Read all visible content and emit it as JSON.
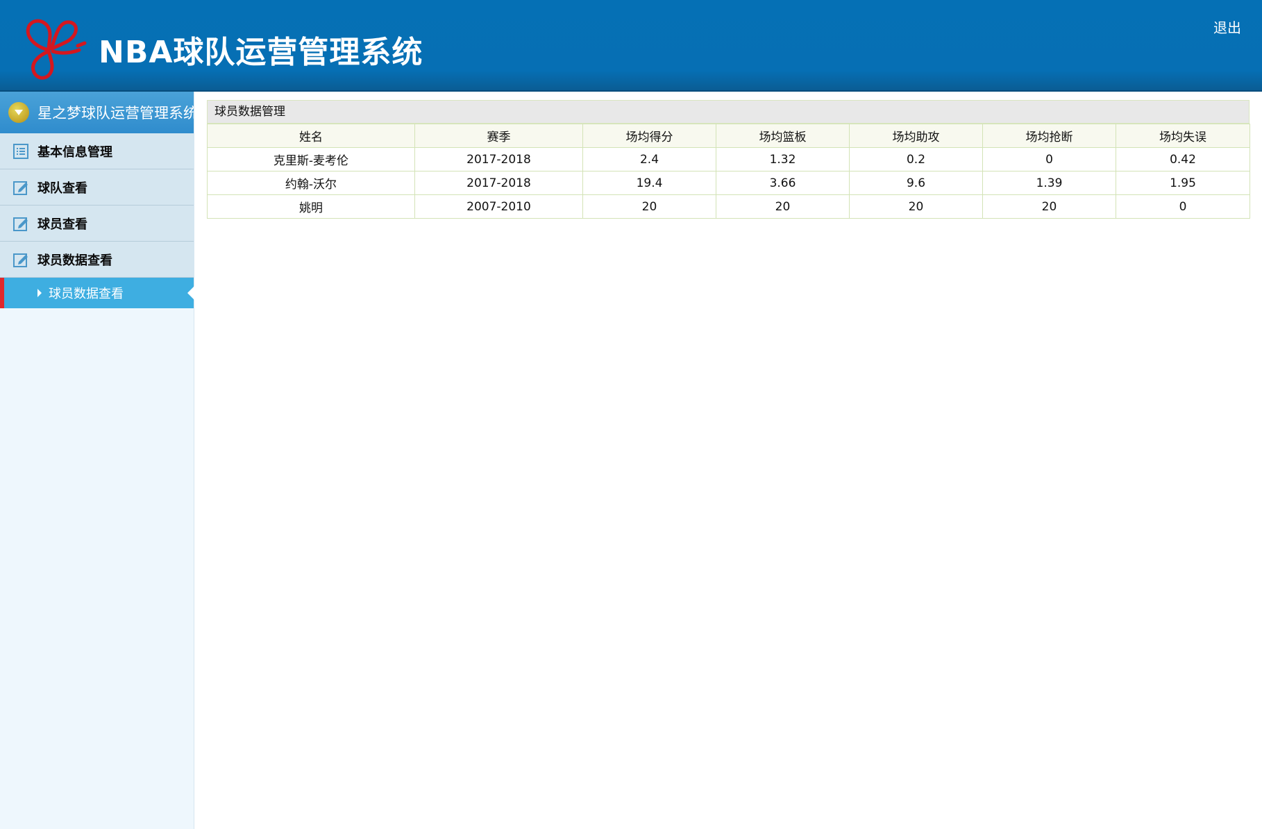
{
  "header": {
    "title": "NBA球队运营管理系统",
    "logout": "退出",
    "logo_icon": "butterfly-logo-icon",
    "colors": {
      "background": "#066fb4",
      "logo": "#d4171f"
    }
  },
  "sidebar": {
    "header_title": "星之梦球队运营管理系统",
    "items": [
      {
        "label": "基本信息管理",
        "icon": "list-icon"
      },
      {
        "label": "球队查看",
        "icon": "edit-icon"
      },
      {
        "label": "球员查看",
        "icon": "edit-icon"
      },
      {
        "label": "球员数据查看",
        "icon": "edit-icon"
      }
    ],
    "active_subitem": {
      "label": "球员数据查看"
    },
    "colors": {
      "active": "#3eaee1",
      "active_marker": "#e0282c"
    }
  },
  "main": {
    "panel_title": "球员数据管理",
    "table": {
      "columns": [
        "姓名",
        "赛季",
        "场均得分",
        "场均篮板",
        "场均助攻",
        "场均抢断",
        "场均失误"
      ],
      "rows": [
        [
          "克里斯-麦考伦",
          "2017-2018",
          "2.4",
          "1.32",
          "0.2",
          "0",
          "0.42"
        ],
        [
          "约翰-沃尔",
          "2017-2018",
          "19.4",
          "3.66",
          "9.6",
          "1.39",
          "1.95"
        ],
        [
          "姚明",
          "2007-2010",
          "20",
          "20",
          "20",
          "20",
          "0"
        ]
      ]
    }
  }
}
